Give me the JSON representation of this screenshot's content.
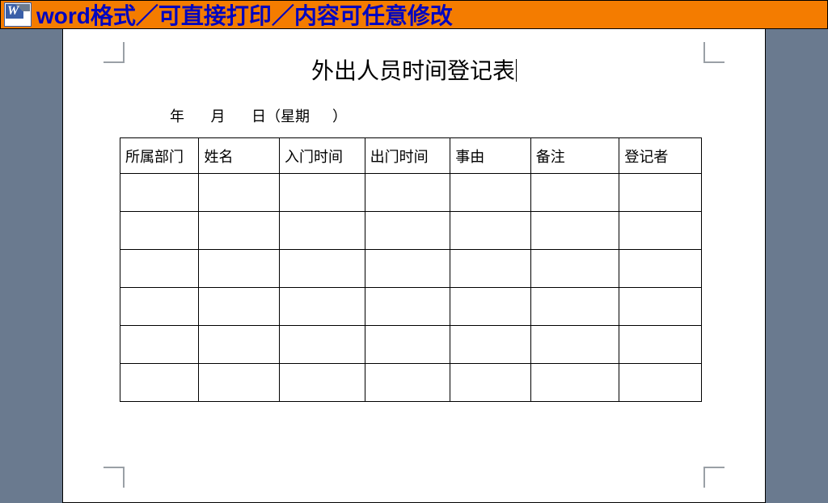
{
  "banner": {
    "text": "word格式／可直接打印／内容可任意修改"
  },
  "document": {
    "title": "外出人员时间登记表",
    "date_line": {
      "year": "年",
      "month": "月",
      "day": "日",
      "weekday_open": "（星期",
      "weekday_close": "）"
    },
    "table": {
      "headers": [
        "所属部门",
        "姓名",
        "入门时间",
        "出门时间",
        "事由",
        "备注",
        "登记者"
      ],
      "rows": [
        [
          "",
          "",
          "",
          "",
          "",
          "",
          ""
        ],
        [
          "",
          "",
          "",
          "",
          "",
          "",
          ""
        ],
        [
          "",
          "",
          "",
          "",
          "",
          "",
          ""
        ],
        [
          "",
          "",
          "",
          "",
          "",
          "",
          ""
        ],
        [
          "",
          "",
          "",
          "",
          "",
          "",
          ""
        ],
        [
          "",
          "",
          "",
          "",
          "",
          "",
          ""
        ]
      ]
    }
  }
}
